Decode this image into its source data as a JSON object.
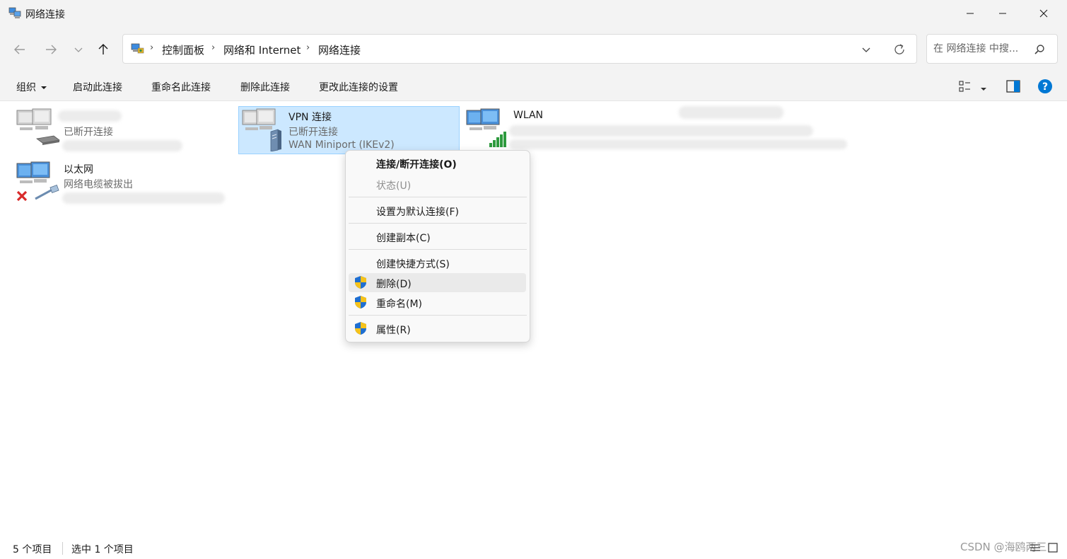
{
  "window": {
    "title": "网络连接"
  },
  "breadcrumb": [
    "控制面板",
    "网络和 Internet",
    "网络连接"
  ],
  "search": {
    "placeholder": "在 网络连接 中搜..."
  },
  "toolbar": {
    "organize": "组织",
    "start": "启动此连接",
    "rename": "重命名此连接",
    "delete": "删除此连接",
    "change": "更改此连接的设置"
  },
  "items": [
    {
      "name": "",
      "status": "已断开连接",
      "device": ""
    },
    {
      "name": "VPN 连接",
      "status": "已断开连接",
      "device": "WAN Miniport (IKEv2)"
    },
    {
      "name": "WLAN",
      "status": "",
      "device": ""
    },
    {
      "name": "以太网",
      "status": "网络电缆被拔出",
      "device": ""
    }
  ],
  "context_menu": [
    {
      "label": "连接/断开连接(O)",
      "shield": false,
      "disabled": false,
      "bold": true
    },
    {
      "label": "状态(U)",
      "shield": false,
      "disabled": true
    },
    {
      "label": "设置为默认连接(F)",
      "shield": false,
      "disabled": false
    },
    {
      "label": "创建副本(C)",
      "shield": false,
      "disabled": false
    },
    {
      "label": "创建快捷方式(S)",
      "shield": false,
      "disabled": false
    },
    {
      "label": "删除(D)",
      "shield": true,
      "disabled": false,
      "hovered": true
    },
    {
      "label": "重命名(M)",
      "shield": true,
      "disabled": false
    },
    {
      "label": "属性(R)",
      "shield": true,
      "disabled": false
    }
  ],
  "status_bar": {
    "count": "5 个项目",
    "selected": "选中 1 个项目"
  },
  "watermark": "CSDN @海鸥两三",
  "colors": {
    "selection": "#cce8ff",
    "selection_border": "#99d1ff",
    "accent": "#0078d4",
    "help": "#0078d4",
    "error": "#d92a2a"
  },
  "icons": [
    "network-connections-icon",
    "minimize-icon",
    "maximize-icon",
    "close-icon",
    "back-arrow-icon",
    "forward-arrow-icon",
    "recent-chevron-icon",
    "up-arrow-icon",
    "control-panel-icon",
    "chevron-down-icon",
    "refresh-icon",
    "search-icon",
    "layout-icon",
    "preview-pane-icon",
    "help-icon",
    "computer-icon",
    "modem-icon",
    "vpn-server-icon",
    "wifi-signal-icon",
    "ethernet-cable-icon",
    "red-x-icon",
    "uac-shield-icon"
  ]
}
